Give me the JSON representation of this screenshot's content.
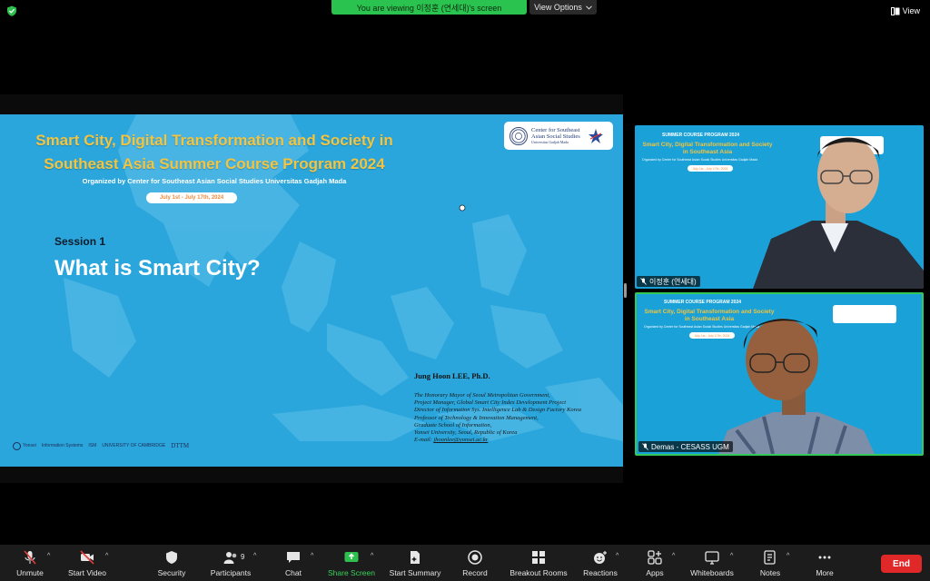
{
  "topbar": {
    "banner": "You are viewing 이정훈 (연세대)'s screen",
    "view_options": "View Options",
    "view": "View"
  },
  "slide": {
    "title_line1": "Smart City, Digital Transformation and Society in",
    "title_line2": "Southeast Asia Summer Course Program 2024",
    "organizer": "Organized by Center for Southeast Asian Social Studies Universitas Gadjah Mada",
    "dates": "July 1st - July 17th, 2024",
    "logo_text": "Center for Southeast Asian Social Studies",
    "logo_sub": "Universitas Gadjah Mada",
    "session": "Session 1",
    "heading": "What is Smart City?",
    "speaker_name": "Jung Hoon LEE, Ph.D.",
    "speaker_lines": [
      "The Honorary Mayor of Seoul Metropolitan Government,",
      "Project Manager, Global Smart City Index Development Project",
      "Director of Information Sys. Intelligence Lab & Design Factory Korea",
      "Professor of Technology & Innovation Management,",
      "Graduate School of Information,",
      "Yonsei University, Seoul, Republic of Korea"
    ],
    "email_label": "E-mail: ",
    "email": "jhoonlee@yonsei.ac.kr",
    "footer_logos": [
      "Yonsei",
      "Information Systems",
      "ISM",
      "UNIVERSITY OF CAMBRIDGE",
      "DTTM"
    ]
  },
  "tiles": [
    {
      "name": "이정훈 (연세대)",
      "bg_program": "SUMMER COURSE PROGRAM 2024",
      "bg_title_line1": "Smart City, Digital Transformation and Society",
      "bg_title_line2": "in Southeast Asia",
      "bg_organizer": "Organized by Center for Southeast Asian Social Studies Universitas Gadjah Mada",
      "bg_dates": "July 1st - July 17th, 2024"
    },
    {
      "name": "Demas - CESASS UGM",
      "bg_program": "SUMMER COURSE PROGRAM 2024",
      "bg_title_line1": "Smart City, Digital Transformation and Society",
      "bg_title_line2": "in Southeast Asia",
      "bg_organizer": "Organized by Center for Southeast Asian Social Studies Universitas Gadjah Mada",
      "bg_dates": "July 1st - July 17th, 2024"
    }
  ],
  "toolbar": {
    "unmute": "Unmute",
    "start_video": "Start Video",
    "security": "Security",
    "participants": "Participants",
    "participants_count": "9",
    "chat": "Chat",
    "share_screen": "Share Screen",
    "start_summary": "Start Summary",
    "record": "Record",
    "breakout_rooms": "Breakout Rooms",
    "reactions": "Reactions",
    "apps": "Apps",
    "whiteboards": "Whiteboards",
    "notes": "Notes",
    "more": "More",
    "end": "End"
  },
  "colors": {
    "slide_bg": "#2aa6dc",
    "title_yellow": "#f3c43f",
    "banner_green": "#2bc34f",
    "end_red": "#e02828",
    "active_speaker": "#34c759"
  }
}
